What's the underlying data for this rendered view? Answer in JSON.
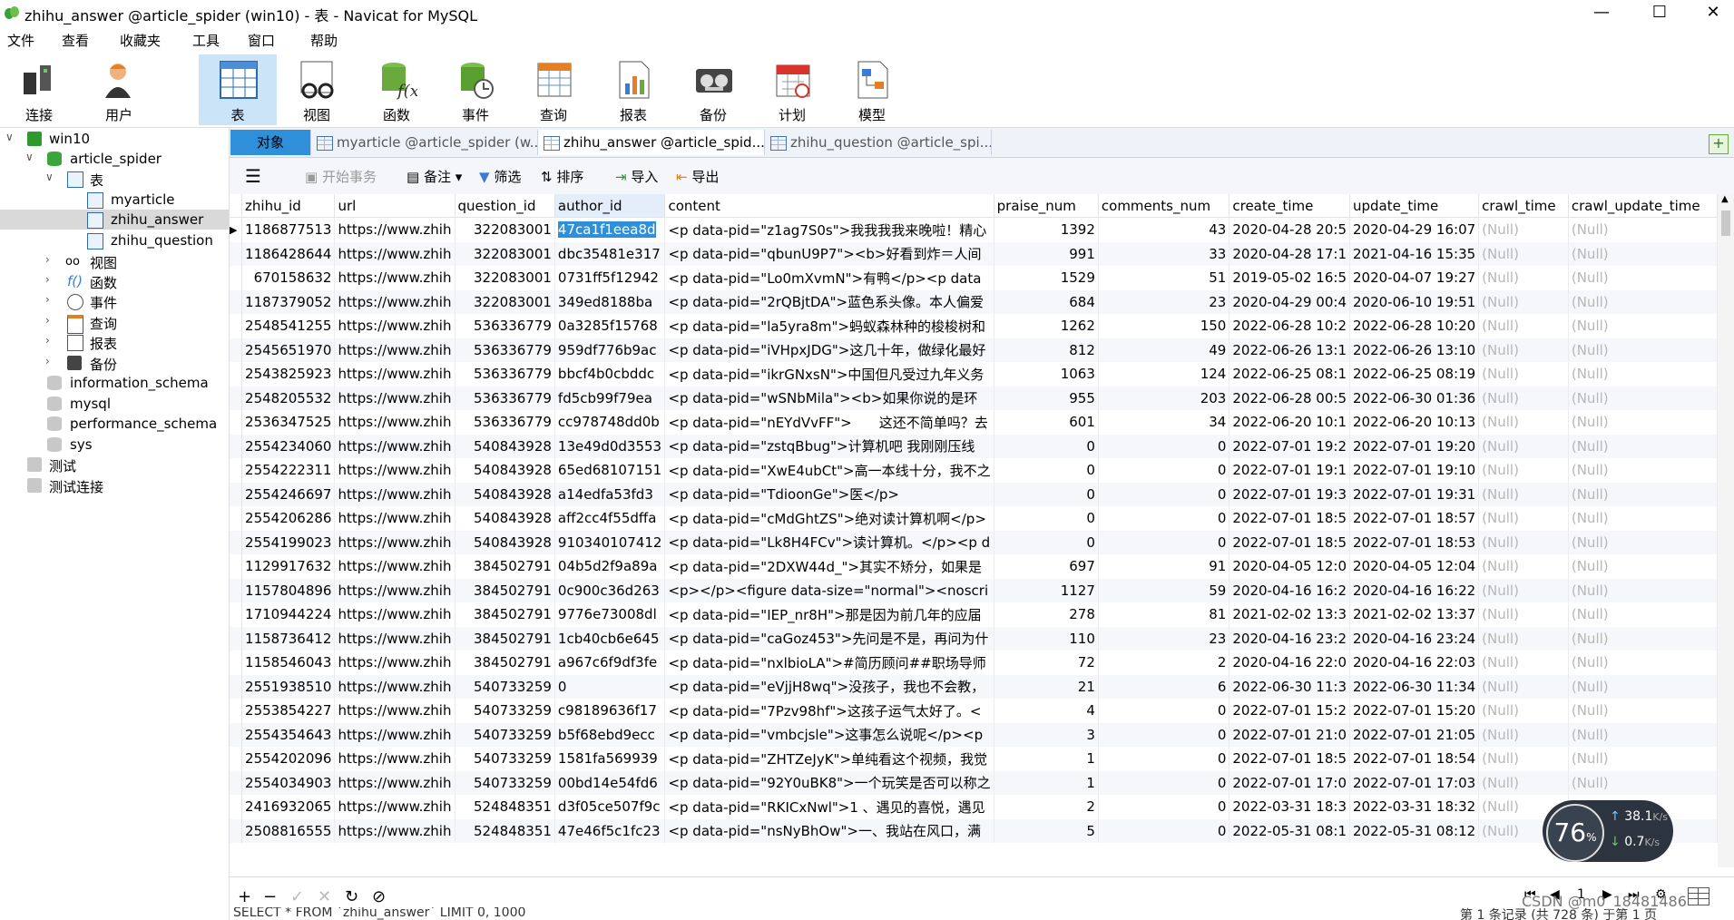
{
  "window": {
    "title": "zhihu_answer @article_spider (win10) - 表 - Navicat for MySQL",
    "minimize": "—",
    "maximize": "☐",
    "close": "✕"
  },
  "menu": [
    "文件",
    "查看",
    "收藏夹",
    "工具",
    "窗口",
    "帮助"
  ],
  "toolbar": [
    {
      "label": "连接",
      "icon": "connection-icon"
    },
    {
      "label": "用户",
      "icon": "user-icon"
    },
    {
      "label": "表",
      "icon": "table-icon",
      "active": true
    },
    {
      "label": "视图",
      "icon": "view-icon"
    },
    {
      "label": "函数",
      "icon": "function-icon"
    },
    {
      "label": "事件",
      "icon": "event-icon"
    },
    {
      "label": "查询",
      "icon": "query-icon"
    },
    {
      "label": "报表",
      "icon": "report-icon"
    },
    {
      "label": "备份",
      "icon": "backup-icon"
    },
    {
      "label": "计划",
      "icon": "schedule-icon"
    },
    {
      "label": "模型",
      "icon": "model-icon"
    }
  ],
  "tree": [
    {
      "label": "win10",
      "level": 0,
      "arrow": "∨",
      "icon": "server-icon"
    },
    {
      "label": "article_spider",
      "level": 1,
      "arrow": "∨",
      "icon": "database-icon"
    },
    {
      "label": "表",
      "level": 2,
      "arrow": "∨",
      "icon": "tables-icon"
    },
    {
      "label": "myarticle",
      "level": 3,
      "icon": "table-icon"
    },
    {
      "label": "zhihu_answer",
      "level": 3,
      "icon": "table-icon",
      "selected": true
    },
    {
      "label": "zhihu_question",
      "level": 3,
      "icon": "table-icon"
    },
    {
      "label": "视图",
      "level": 2,
      "arrow": "›",
      "icon": "view-icon"
    },
    {
      "label": "函数",
      "level": 2,
      "arrow": "›",
      "icon": "function-icon"
    },
    {
      "label": "事件",
      "level": 2,
      "arrow": "›",
      "icon": "event-icon"
    },
    {
      "label": "查询",
      "level": 2,
      "arrow": "›",
      "icon": "query-icon"
    },
    {
      "label": "报表",
      "level": 2,
      "arrow": "›",
      "icon": "report-icon"
    },
    {
      "label": "备份",
      "level": 2,
      "arrow": "›",
      "icon": "backup-icon"
    },
    {
      "label": "information_schema",
      "level": 1,
      "icon": "database-gray-icon"
    },
    {
      "label": "mysql",
      "level": 1,
      "icon": "database-gray-icon"
    },
    {
      "label": "performance_schema",
      "level": 1,
      "icon": "database-gray-icon"
    },
    {
      "label": "sys",
      "level": 1,
      "icon": "database-gray-icon"
    },
    {
      "label": "测试",
      "level": 0,
      "icon": "server-gray-icon"
    },
    {
      "label": "测试连接",
      "level": 0,
      "icon": "server-gray-icon"
    }
  ],
  "tabs": [
    {
      "label": "对象"
    },
    {
      "label": "myarticle @article_spider (w..."
    },
    {
      "label": "zhihu_answer @article_spid..."
    },
    {
      "label": "zhihu_question @article_spi..."
    }
  ],
  "subtoolbar": {
    "begin_tx": "开始事务",
    "note": "备注",
    "filter": "筛选",
    "sort": "排序",
    "import": "导入",
    "export": "导出"
  },
  "grid": {
    "columns": [
      "zhihu_id",
      "url",
      "question_id",
      "author_id",
      "content",
      "praise_num",
      "comments_num",
      "create_time",
      "update_time",
      "crawl_time",
      "crawl_update_time"
    ],
    "rows": [
      [
        "1186877513",
        "https://www.zhih",
        "322083001",
        "47ca1f1eea8d",
        "<p data-pid=\"z1ag7S0s\">我我我我来晚啦！精心",
        "1392",
        "43",
        "2020-04-28 20:5",
        "2020-04-29 16:07",
        "(Null)",
        "(Null)"
      ],
      [
        "1186428644",
        "https://www.zhih",
        "322083001",
        "dbc35481e317",
        "<p data-pid=\"qbunU9P7\"><b>好看到炸＝人间",
        "991",
        "33",
        "2020-04-28 17:1",
        "2021-04-16 15:35",
        "(Null)",
        "(Null)"
      ],
      [
        "670158632",
        "https://www.zhih",
        "322083001",
        "0731ff5f12942",
        "<p data-pid=\"Lo0mXvmN\">有鸭</p><p data",
        "1529",
        "51",
        "2019-05-02 16:5",
        "2020-04-07 19:27",
        "(Null)",
        "(Null)"
      ],
      [
        "1187379052",
        "https://www.zhih",
        "322083001",
        "349ed8188ba",
        "<p data-pid=\"2rQBjtDA\">蓝色系头像。本人偏爱",
        "684",
        "23",
        "2020-04-29 00:4",
        "2020-06-10 19:51",
        "(Null)",
        "(Null)"
      ],
      [
        "2548541255",
        "https://www.zhih",
        "536336779",
        "0a3285f15768",
        "<p data-pid=\"la5yra8m\">蚂蚁森林种的梭梭树和",
        "1262",
        "150",
        "2022-06-28 10:2",
        "2022-06-28 10:20",
        "(Null)",
        "(Null)"
      ],
      [
        "2545651970",
        "https://www.zhih",
        "536336779",
        "959df776b9ac",
        "<p data-pid=\"iVHpxJDG\">这几十年，做绿化最好",
        "812",
        "49",
        "2022-06-26 13:1",
        "2022-06-26 13:10",
        "(Null)",
        "(Null)"
      ],
      [
        "2543825923",
        "https://www.zhih",
        "536336779",
        "bbcf4b0cbddc",
        "<p data-pid=\"ikrGNxsN\">中国但凡受过九年义务",
        "1063",
        "124",
        "2022-06-25 08:1",
        "2022-06-25 08:19",
        "(Null)",
        "(Null)"
      ],
      [
        "2548205532",
        "https://www.zhih",
        "536336779",
        "fd5cb99f79ea",
        "<p data-pid=\"wSNbMila\"><b>如果你说的是环",
        "955",
        "203",
        "2022-06-28 00:5",
        "2022-06-30 01:36",
        "(Null)",
        "(Null)"
      ],
      [
        "2536347525",
        "https://www.zhih",
        "536336779",
        "cc978748dd0b",
        "<p data-pid=\"nEYdVvFF\">　　这还不简单吗？去",
        "601",
        "34",
        "2022-06-20 10:1",
        "2022-06-20 10:13",
        "(Null)",
        "(Null)"
      ],
      [
        "2554234060",
        "https://www.zhih",
        "540843928",
        "13e49d0d3553",
        "<p data-pid=\"zstqBbug\">计算机吧 我刚刚压线",
        "0",
        "0",
        "2022-07-01 19:2",
        "2022-07-01 19:20",
        "(Null)",
        "(Null)"
      ],
      [
        "2554222311",
        "https://www.zhih",
        "540843928",
        "65ed68107151",
        "<p data-pid=\"XwE4ubCt\">高一本线十分，我不之",
        "0",
        "0",
        "2022-07-01 19:1",
        "2022-07-01 19:10",
        "(Null)",
        "(Null)"
      ],
      [
        "2554246697",
        "https://www.zhih",
        "540843928",
        "a14edfa53fd3",
        "<p data-pid=\"TdioonGe\">医</p>",
        "0",
        "0",
        "2022-07-01 19:3",
        "2022-07-01 19:31",
        "(Null)",
        "(Null)"
      ],
      [
        "2554206286",
        "https://www.zhih",
        "540843928",
        "aff2cc4f55dffa",
        "<p data-pid=\"cMdGhtZS\">绝对读计算机啊</p>",
        "0",
        "0",
        "2022-07-01 18:5",
        "2022-07-01 18:57",
        "(Null)",
        "(Null)"
      ],
      [
        "2554199023",
        "https://www.zhih",
        "540843928",
        "910340107412",
        "<p data-pid=\"Lk8H4FCv\">读计算机。</p><p d",
        "0",
        "0",
        "2022-07-01 18:5",
        "2022-07-01 18:53",
        "(Null)",
        "(Null)"
      ],
      [
        "1129917632",
        "https://www.zhih",
        "384502791",
        "04b5d2f9a89a",
        "<p data-pid=\"2DXW44d_\">其实不矫分，如果是",
        "697",
        "91",
        "2020-04-05 12:0",
        "2020-04-05 12:04",
        "(Null)",
        "(Null)"
      ],
      [
        "1157804896",
        "https://www.zhih",
        "384502791",
        "0c900c36d263",
        "<p></p><figure data-size=\"normal\"><noscri",
        "1127",
        "59",
        "2020-04-16 16:2",
        "2020-04-16 16:22",
        "(Null)",
        "(Null)"
      ],
      [
        "1710944224",
        "https://www.zhih",
        "384502791",
        "9776e73008dl",
        "<p data-pid=\"IEP_nr8H\">那是因为前几年的应届",
        "278",
        "81",
        "2021-02-02 13:3",
        "2021-02-02 13:37",
        "(Null)",
        "(Null)"
      ],
      [
        "1158736412",
        "https://www.zhih",
        "384502791",
        "1cb40cb6e645",
        "<p data-pid=\"caGoz453\">先问是不是，再问为什",
        "110",
        "23",
        "2020-04-16 23:2",
        "2020-04-16 23:24",
        "(Null)",
        "(Null)"
      ],
      [
        "1158546043",
        "https://www.zhih",
        "384502791",
        "a967c6f9df3fe",
        "<p data-pid=\"nxlbioLA\">#简历顾问##职场导师",
        "72",
        "2",
        "2020-04-16 22:0",
        "2020-04-16 22:03",
        "(Null)",
        "(Null)"
      ],
      [
        "2551938510",
        "https://www.zhih",
        "540733259",
        "0",
        "<p data-pid=\"eVjjH8wq\">没孩子，我也不会教，",
        "21",
        "6",
        "2022-06-30 11:3",
        "2022-06-30 11:34",
        "(Null)",
        "(Null)"
      ],
      [
        "2553854227",
        "https://www.zhih",
        "540733259",
        "c98189636f17",
        "<p data-pid=\"7Pzv98hf\">这孩子运气太好了。<",
        "4",
        "0",
        "2022-07-01 15:2",
        "2022-07-01 15:20",
        "(Null)",
        "(Null)"
      ],
      [
        "2554354643",
        "https://www.zhih",
        "540733259",
        "b5f68ebd9ecc",
        "<p data-pid=\"vmbcjsle\">这事怎么说呢</p><p",
        "3",
        "0",
        "2022-07-01 21:0",
        "2022-07-01 21:05",
        "(Null)",
        "(Null)"
      ],
      [
        "2554202096",
        "https://www.zhih",
        "540733259",
        "1581fa569939",
        "<p data-pid=\"ZHTZeJyK\">单纯看这个视频，我觉",
        "1",
        "0",
        "2022-07-01 18:5",
        "2022-07-01 18:54",
        "(Null)",
        "(Null)"
      ],
      [
        "2554034903",
        "https://www.zhih",
        "540733259",
        "00bd14e54fd6",
        "<p data-pid=\"92Y0uBK8\">一个玩笑是否可以称之",
        "1",
        "0",
        "2022-07-01 17:0",
        "2022-07-01 17:03",
        "(Null)",
        "(Null)"
      ],
      [
        "2416932065",
        "https://www.zhih",
        "524848351",
        "d3f05ce507f9c",
        "<p data-pid=\"RKICxNwl\">1 、遇见的喜悦，遇见",
        "2",
        "0",
        "2022-03-31 18:3",
        "2022-03-31 18:32",
        "(Null)",
        "(Null)"
      ],
      [
        "2508816555",
        "https://www.zhih",
        "524848351",
        "47e46f5c1fc23",
        "<p data-pid=\"nsNyBhOw\">一、我站在风口，满",
        "5",
        "0",
        "2022-05-31 08:1",
        "2022-05-31 08:12",
        "(Null)",
        "(Null)"
      ]
    ]
  },
  "bottom_toolbar": [
    "+",
    "−",
    "✓",
    "✕",
    "↻",
    "⊘"
  ],
  "nav_buttons": [
    "⏮",
    "◀",
    "1",
    "▶",
    "⏭",
    "⚙"
  ],
  "status": {
    "sql": "SELECT * FROM `zhihu_answer` LIMIT 0, 1000",
    "records": "第 1 条记录 (共 728 条) 于第 1 页"
  },
  "speed_widget": {
    "percent": "76",
    "percent_unit": "%",
    "up": "38.1",
    "up_unit": "K/s",
    "down": "0.7",
    "down_unit": "K/s"
  },
  "watermark": "CSDN @m0_18481486"
}
